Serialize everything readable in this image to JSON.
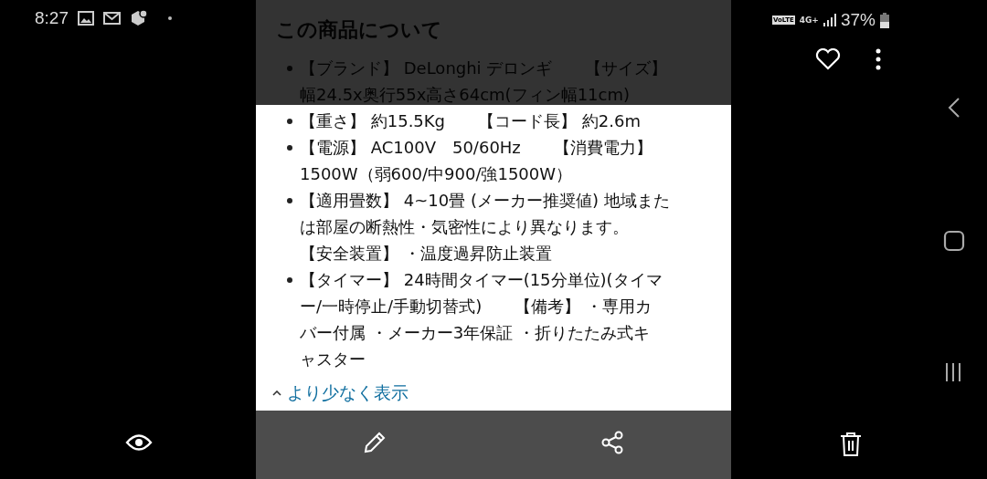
{
  "status_bar": {
    "time": "8:27",
    "volte": "VoLTE",
    "network": "4G+",
    "battery": "37%"
  },
  "product": {
    "title": "この商品について",
    "bullets": [
      {
        "lines": [
          "【ブランド】 DeLonghi デロンギ　　【サイズ】",
          "幅24.5x奥行55x高さ64cm(フィン幅11cm)"
        ]
      },
      {
        "lines": [
          "【重さ】 約15.5Kg　　【コード長】 約2.6m"
        ]
      },
      {
        "lines": [
          "【電源】 AC100V　50/60Hz　　【消費電力】",
          "1500W（弱600/中900/強1500W）"
        ]
      },
      {
        "lines": [
          "【適用畳数】 4~10畳 (メーカー推奨値) 地域また",
          "は部屋の断熱性・気密性により異なります。",
          "【安全装置】 ・温度過昇防止装置"
        ]
      },
      {
        "lines": [
          "【タイマー】 24時間タイマー(15分単位)(タイマ",
          "ー/一時停止/手動切替式)　　【備考】 ・専用カ",
          "バー付属 ・メーカー3年保証 ・折りたたみ式キ",
          "ャスター"
        ]
      }
    ],
    "show_less": "より少なく表示"
  }
}
